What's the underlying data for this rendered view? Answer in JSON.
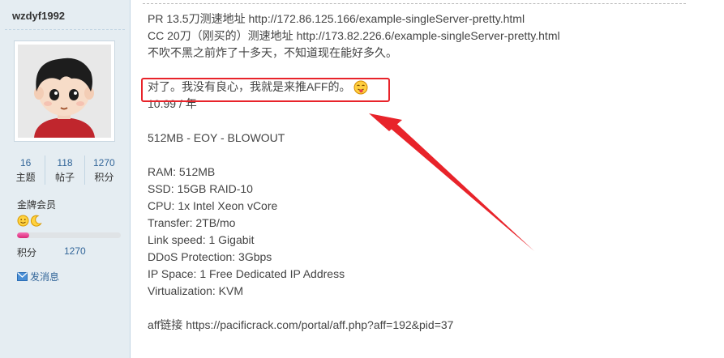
{
  "sidebar": {
    "username": "wzdyf1992",
    "stats": [
      {
        "value": "16",
        "label": "主题"
      },
      {
        "value": "118",
        "label": "帖子"
      },
      {
        "value": "1270",
        "label": "积分"
      }
    ],
    "rank": "金牌会员",
    "rank_icons": [
      "smiley-icon",
      "moon-icon"
    ],
    "progress_fraction": 0.12,
    "points_label": "积分",
    "points_value": "1270",
    "pm_label": "发消息"
  },
  "post": {
    "lines": [
      "PR 13.5刀测速地址    http://172.86.125.166/example-singleServer-pretty.html",
      "CC 20刀（刚买的）测速地址     http://173.82.226.6/example-singleServer-pretty.html",
      "不吹不黑之前炸了十多天，不知道现在能好多久。",
      "",
      "对了。我没有良心，我就是来推AFF的。",
      "10.99 / 年",
      "",
      "512MB - EOY - BLOWOUT",
      "",
      "RAM: 512MB",
      "SSD: 15GB RAID-10",
      "CPU: 1x Intel Xeon vCore",
      "Transfer: 2TB/mo",
      "Link speed: 1 Gigabit",
      "DDoS Protection: 3Gbps",
      "IP Space: 1 Free Dedicated IP Address",
      "Virtualization: KVM",
      "",
      "aff链接 https://pacificrack.com/portal/aff.php?aff=192&pid=37"
    ]
  },
  "colors": {
    "sidebar_bg": "#e5edf2",
    "annotation_red": "#e8232a",
    "link_blue": "#336699"
  }
}
